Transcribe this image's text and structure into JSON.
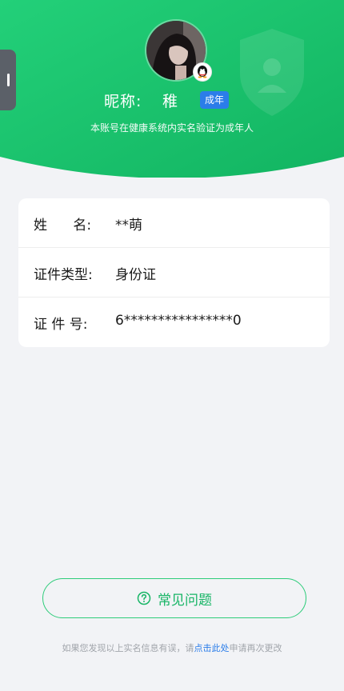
{
  "header": {
    "nickname_label": "昵称:",
    "nickname_value": "稚",
    "age_badge": "成年",
    "subtitle": "本账号在健康系统内实名验证为成年人",
    "avatar_icon": "user-avatar",
    "badge_icon": "qq-penguin-icon",
    "colors": {
      "green_start": "#1fcf73",
      "green_end": "#14b862",
      "badge_blue": "#2b7de9"
    }
  },
  "info": {
    "rows": [
      {
        "label": "姓      名:",
        "value": "**萌"
      },
      {
        "label": "证件类型:",
        "value": "身份证"
      },
      {
        "label": "证 件 号:",
        "value": "6****************0"
      }
    ]
  },
  "faq": {
    "label": "常见问题",
    "icon": "question-circle-icon"
  },
  "footer": {
    "prefix": "如果您发现以上实名信息有误，请",
    "link": "点击此处",
    "suffix": "申请再次更改"
  }
}
